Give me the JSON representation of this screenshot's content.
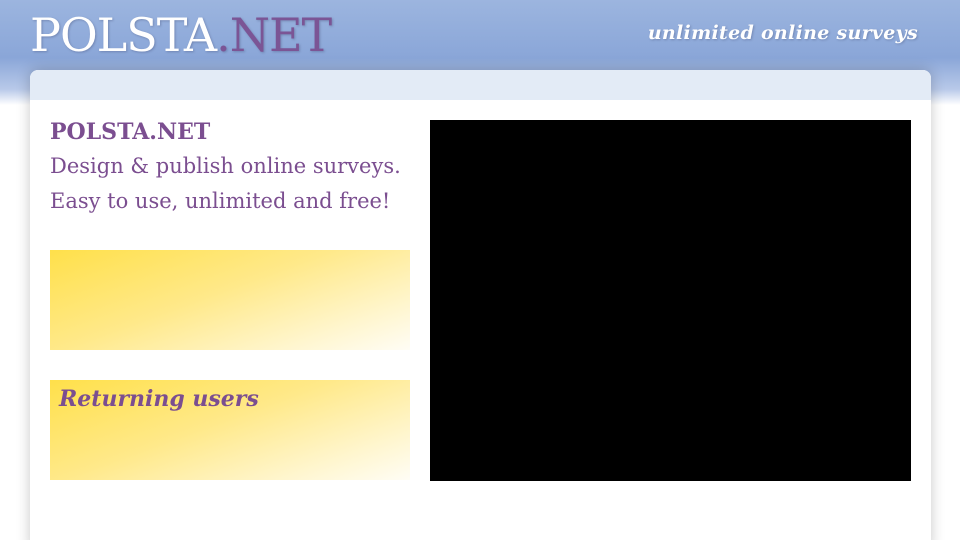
{
  "header": {
    "logo_main": "POLSTA",
    "logo_accent": ".NET",
    "tagline": "unlimited online surveys"
  },
  "intro": {
    "title": "POLSTA.NET",
    "line1": "Design & publish online surveys.",
    "line2": "Easy to use, unlimited and free!"
  },
  "boxes": {
    "new_user_heading": "",
    "returning_heading": "Returning users"
  },
  "colors": {
    "header_blue": "#8aa6d8",
    "accent_purple": "#7b4e90",
    "yellow": "#ffe04a",
    "video_bg": "#000000"
  }
}
